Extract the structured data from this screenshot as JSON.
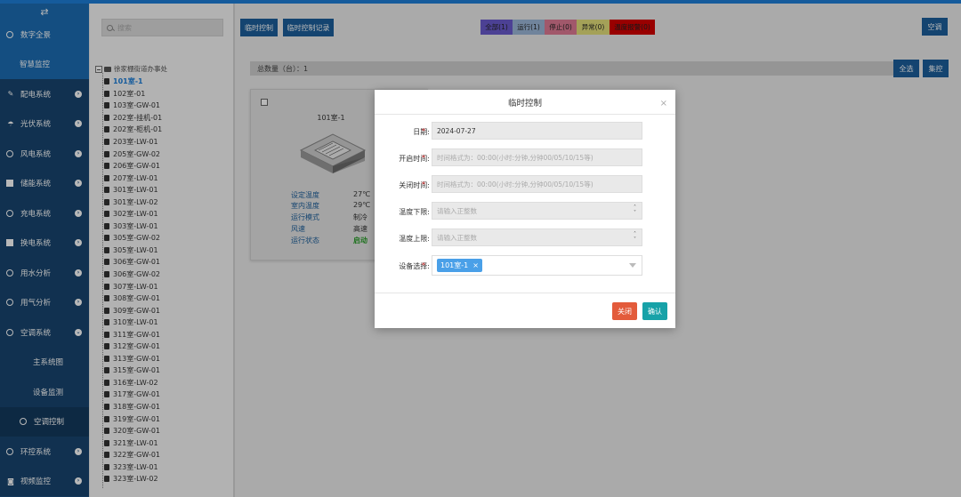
{
  "sidebar": {
    "items": [
      {
        "label": "数字全景"
      },
      {
        "label": "智慧监控"
      },
      {
        "label": "配电系统"
      },
      {
        "label": "光伏系统"
      },
      {
        "label": "风电系统"
      },
      {
        "label": "储能系统"
      },
      {
        "label": "充电系统"
      },
      {
        "label": "换电系统"
      },
      {
        "label": "用水分析"
      },
      {
        "label": "用气分析"
      },
      {
        "label": "空调系统"
      },
      {
        "label": "主系统图"
      },
      {
        "label": "设备监测"
      },
      {
        "label": "空调控制"
      },
      {
        "label": "环控系统"
      },
      {
        "label": "视频监控"
      }
    ]
  },
  "tree": {
    "search_placeholder": "搜索",
    "root_label": "徐家棚街道办事处",
    "nodes": [
      "101室-1",
      "102室-01",
      "103室-GW-01",
      "202室-挂机-01",
      "202室-柜机-01",
      "203室-LW-01",
      "205室-GW-02",
      "206室-GW-01",
      "207室-LW-01",
      "301室-LW-01",
      "301室-LW-02",
      "302室-LW-01",
      "303室-LW-01",
      "305室-GW-02",
      "305室-LW-01",
      "306室-GW-01",
      "306室-GW-02",
      "307室-LW-01",
      "308室-GW-01",
      "309室-GW-01",
      "310室-LW-01",
      "311室-GW-01",
      "312室-GW-01",
      "313室-GW-01",
      "315室-GW-01",
      "316室-LW-02",
      "317室-GW-01",
      "318室-GW-01",
      "319室-GW-01",
      "320室-GW-01",
      "321室-LW-01",
      "322室-GW-01",
      "323室-LW-01",
      "323室-LW-02"
    ]
  },
  "toolbar": {
    "temp_control": "临时控制",
    "temp_control_log": "临时控制记录",
    "filters": [
      {
        "label": "全部(1)",
        "color": "#6a5acd"
      },
      {
        "label": "运行(1)",
        "color": "#9bb8d8"
      },
      {
        "label": "停止(0)",
        "color": "#e07a95"
      },
      {
        "label": "异常(0)",
        "color": "#e3df7a"
      },
      {
        "label": "温度报警(0)",
        "color": "#d40000"
      }
    ],
    "ac_button": "空调",
    "select_all": "全选",
    "group_control": "集控"
  },
  "summary": {
    "count_text": "总数量（台）：1"
  },
  "card": {
    "name": "101室-1",
    "props": [
      {
        "k": "设定温度",
        "v": "27℃"
      },
      {
        "k": "室内温度",
        "v": "29℃"
      },
      {
        "k": "运行模式",
        "v": "制冷"
      },
      {
        "k": "风速",
        "v": "高速"
      },
      {
        "k": "运行状态",
        "v": "启动"
      }
    ]
  },
  "modal": {
    "title": "临时控制",
    "close_glyph": "×",
    "date_label": "日期:",
    "date_value": "2024-07-27",
    "start_label": "开启时间:",
    "start_placeholder": "时间格式为：00:00(小时:分钟,分钟00/05/10/15等)",
    "end_label": "关闭时间:",
    "end_placeholder": "时间格式为：00:00(小时:分钟,分钟00/05/10/15等)",
    "temp_low_label": "温度下限:",
    "temp_low_placeholder": "请输入正整数",
    "temp_high_label": "温度上限:",
    "temp_high_placeholder": "请输入正整数",
    "device_label": "设备选择:",
    "device_tag": "101室-1",
    "cancel": "关闭",
    "confirm": "确认"
  }
}
